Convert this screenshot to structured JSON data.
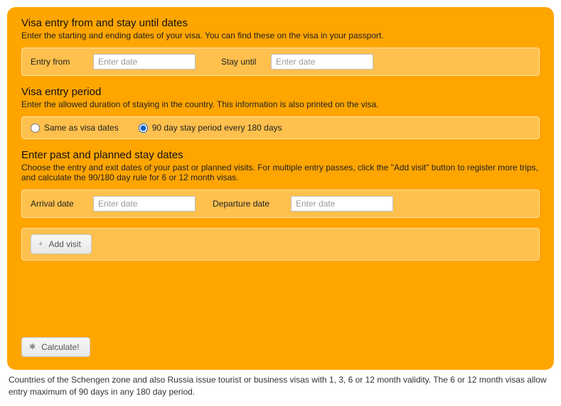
{
  "section1": {
    "title": "Visa entry from and stay until dates",
    "desc": "Enter the starting and ending dates of your visa. You can find these on the visa in your passport.",
    "entry_from_label": "Entry from",
    "entry_from_placeholder": "Enter date",
    "stay_until_label": "Stay until",
    "stay_until_placeholder": "Enter date"
  },
  "section2": {
    "title": "Visa entry period",
    "desc": "Enter the allowed duration of staying in the country. This information is also printed on the visa.",
    "option_same": "Same as visa dates",
    "option_90_180": "90 day stay period every 180 days",
    "selected": "90_180"
  },
  "section3": {
    "title": "Enter past and planned stay dates",
    "desc": "Choose the entry and exit dates of your past or planned visits. For multiple entry passes, click the \"Add visit\" button to register more trips, and calculate the 90/180 day rule for 6 or 12 month visas.",
    "arrival_label": "Arrival date",
    "arrival_placeholder": "Enter date",
    "departure_label": "Departure date",
    "departure_placeholder": "Enter date",
    "add_visit_label": "Add visit"
  },
  "calculate_label": "Calculate!",
  "footer": "Countries of the Schengen zone and also Russia issue tourist or business visas with 1, 3, 6 or 12 month validity. The 6 or 12 month visas allow entry maximum of 90 days in any 180 day period."
}
